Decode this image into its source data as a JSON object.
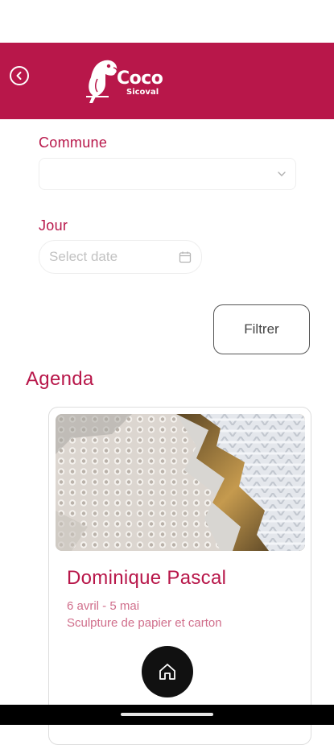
{
  "header": {
    "logo_main": "Coco",
    "logo_sub": "Sicoval",
    "brand_color": "#b8174a"
  },
  "filters": {
    "commune_label": "Commune",
    "commune_value": "",
    "jour_label": "Jour",
    "date_placeholder": "Select date",
    "filter_button": "Filtrer"
  },
  "agenda": {
    "title": "Agenda",
    "events": [
      {
        "title": "Dominique Pascal",
        "date": "6 avril - 5 mai",
        "description": "Sculpture de papier et carton"
      }
    ]
  },
  "icons": {
    "back": "arrow-left-circle-icon",
    "chevron": "chevron-down-icon",
    "calendar": "calendar-icon",
    "home": "home-icon"
  }
}
